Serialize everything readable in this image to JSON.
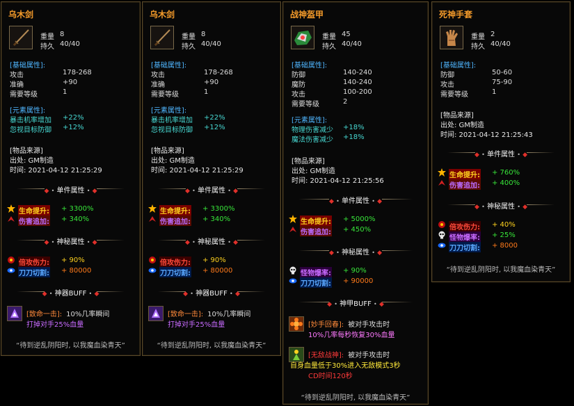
{
  "panels": [
    {
      "title": "乌木剑",
      "icon": "sword-icon",
      "weight_label": "重量",
      "weight": "8",
      "dur_label": "持久",
      "dur": "40/40",
      "base_header": "[基础属性]:",
      "base": [
        [
          "攻击",
          "178-268"
        ],
        [
          "准确",
          "+90"
        ],
        [
          "需要等级",
          "1"
        ]
      ],
      "elem_header": "[元素属性]:",
      "elem": [
        [
          "暴击机率增加",
          "+22%"
        ],
        [
          "忽视目标防御",
          "+12%"
        ]
      ],
      "src_header": "[物品来源]",
      "src_from": "出处: GM制造",
      "src_time": "时间: 2021-04-12 21:25:29",
      "div1": "单件属性",
      "aff1": [
        {
          "icon": "star-icon",
          "label": "生命提升:",
          "value": "+ 3300%",
          "lc": "#ffd21e",
          "lbg": "#7a0000",
          "vc": "#38e63a"
        },
        {
          "icon": "wing-icon",
          "label": "伤害追加:",
          "value": "+ 340%",
          "lc": "#b96bff",
          "lbg": "#5a0a00",
          "vc": "#38e63a"
        }
      ],
      "div2": "神秘属性",
      "aff2": [
        {
          "icon": "rune-icon",
          "label": "倍攻伤力:",
          "value": "+ 90%",
          "lc": "#ff4a3a",
          "lbg": "#3a0000",
          "vc": "#ffd21e"
        },
        {
          "icon": "eye-icon",
          "label": "刀刀切割:",
          "value": "+ 80000",
          "lc": "#5aa8ff",
          "lbg": "#001a4a",
          "vc": "#ff7a1a"
        }
      ],
      "div3": "神器BUFF",
      "buff_name_tag": "[致命一击]:",
      "buff_name_rest": "10%几率瞬间",
      "buff_line2": "打掉对手25%血量",
      "quote": "“待到逆乱阴阳时, 以我魔血染青天”"
    },
    {
      "title": "乌木剑",
      "icon": "sword-icon",
      "weight_label": "重量",
      "weight": "8",
      "dur_label": "持久",
      "dur": "40/40",
      "base_header": "[基础属性]:",
      "base": [
        [
          "攻击",
          "178-268"
        ],
        [
          "准确",
          "+90"
        ],
        [
          "需要等级",
          "1"
        ]
      ],
      "elem_header": "[元素属性]:",
      "elem": [
        [
          "暴击机率增加",
          "+22%"
        ],
        [
          "忽视目标防御",
          "+12%"
        ]
      ],
      "src_header": "[物品来源]",
      "src_from": "出处: GM制造",
      "src_time": "时间: 2021-04-12 21:25:29",
      "div1": "单件属性",
      "aff1": [
        {
          "icon": "star-icon",
          "label": "生命提升:",
          "value": "+ 3300%",
          "lc": "#ffd21e",
          "lbg": "#7a0000",
          "vc": "#38e63a"
        },
        {
          "icon": "wing-icon",
          "label": "伤害追加:",
          "value": "+ 340%",
          "lc": "#b96bff",
          "lbg": "#5a0a00",
          "vc": "#38e63a"
        }
      ],
      "div2": "神秘属性",
      "aff2": [
        {
          "icon": "rune-icon",
          "label": "倍攻伤力:",
          "value": "+ 90%",
          "lc": "#ff4a3a",
          "lbg": "#3a0000",
          "vc": "#ffd21e"
        },
        {
          "icon": "eye-icon",
          "label": "刀刀切割:",
          "value": "+ 80000",
          "lc": "#5aa8ff",
          "lbg": "#001a4a",
          "vc": "#ff7a1a"
        }
      ],
      "div3": "神器BUFF",
      "buff_name_tag": "[致命一击]:",
      "buff_name_rest": "10%几率瞬间",
      "buff_line2": "打掉对手25%血量",
      "quote": "“待到逆乱阴阳时, 以我魔血染青天”"
    },
    {
      "title": "战神盔甲",
      "icon": "armor-icon",
      "weight_label": "重量",
      "weight": "45",
      "dur_label": "持久",
      "dur": "40/40",
      "base_header": "[基础属性]:",
      "base": [
        [
          "防御",
          "140-240"
        ],
        [
          "魔防",
          "140-240"
        ],
        [
          "攻击",
          "100-200"
        ],
        [
          "需要等级",
          "2"
        ]
      ],
      "elem_header": "[元素属性]:",
      "elem": [
        [
          "物理伤害减少",
          "+18%"
        ],
        [
          "魔法伤害减少",
          "+18%"
        ]
      ],
      "src_header": "[物品来源]",
      "src_from": "出处: GM制造",
      "src_time": "时间: 2021-04-12 21:25:56",
      "div1": "单件属性",
      "aff1": [
        {
          "icon": "star-icon",
          "label": "生命提升:",
          "value": "+ 5000%",
          "lc": "#ffd21e",
          "lbg": "#7a0000",
          "vc": "#38e63a"
        },
        {
          "icon": "wing-icon",
          "label": "伤害追加:",
          "value": "+ 450%",
          "lc": "#b96bff",
          "lbg": "#5a0a00",
          "vc": "#38e63a"
        }
      ],
      "div2": "神秘属性",
      "aff2": [
        {
          "icon": "skull-icon",
          "label": "怪物爆率:",
          "value": "+ 90%",
          "lc": "#c86bff",
          "lbg": "#2a003a",
          "vc": "#38e63a"
        },
        {
          "icon": "eye-icon",
          "label": "刀刀切割:",
          "value": "+ 90000",
          "lc": "#5aa8ff",
          "lbg": "#001a4a",
          "vc": "#ff7a1a"
        }
      ],
      "div3": "神甲BUFF",
      "buffs": [
        {
          "icon": "flower-icon",
          "tag": "[妙手回春]:",
          "rest": "被对手攻击时",
          "l2": "10%几率每秒恢复30%血量",
          "l3": "",
          "tc": "#ff8a3a",
          "l2c": "#ff7aff"
        },
        {
          "icon": "warrior-icon",
          "tag": "[无敌战神]:",
          "rest": "被对手攻击时",
          "l2": "自身血量低于30%进入无敌模式3秒",
          "l3": "CD时间120秒",
          "tc": "#ff3a3a",
          "l2c": "#ffe93a"
        }
      ],
      "quote": "“待到逆乱阴阳时, 以我魔血染青天”"
    },
    {
      "title": "死神手套",
      "icon": "gauntlet-icon",
      "weight_label": "重量",
      "weight": "2",
      "dur_label": "持久",
      "dur": "40/40",
      "base_header": "[基础属性]:",
      "base": [
        [
          "防御",
          "50-60"
        ],
        [
          "攻击",
          "75-90"
        ],
        [
          "需要等级",
          "1"
        ]
      ],
      "src_header": "[物品来源]",
      "src_from": "出处: GM制造",
      "src_time": "时间: 2021-04-12 21:25:43",
      "div1": "单件属性",
      "aff1": [
        {
          "icon": "star-icon",
          "label": "生命提升:",
          "value": "+ 760%",
          "lc": "#ffd21e",
          "lbg": "#7a0000",
          "vc": "#38e63a"
        },
        {
          "icon": "wing-icon",
          "label": "伤害追加:",
          "value": "+ 400%",
          "lc": "#b96bff",
          "lbg": "#5a0a00",
          "vc": "#38e63a"
        }
      ],
      "div2": "神秘属性",
      "aff2": [
        {
          "icon": "rune-icon",
          "label": "倍攻伤力:",
          "value": "+ 40%",
          "lc": "#ff4a3a",
          "lbg": "#3a0000",
          "vc": "#ffd21e"
        },
        {
          "icon": "skull-icon",
          "label": "怪物爆率:",
          "value": "+ 25%",
          "lc": "#c86bff",
          "lbg": "#2a003a",
          "vc": "#38e63a"
        },
        {
          "icon": "eye-icon",
          "label": "刀刀切割:",
          "value": "+ 8000",
          "lc": "#5aa8ff",
          "lbg": "#001a4a",
          "vc": "#ff7a1a"
        }
      ],
      "quote": "“待到逆乱阴阳时, 以我魔血染青天”"
    }
  ]
}
